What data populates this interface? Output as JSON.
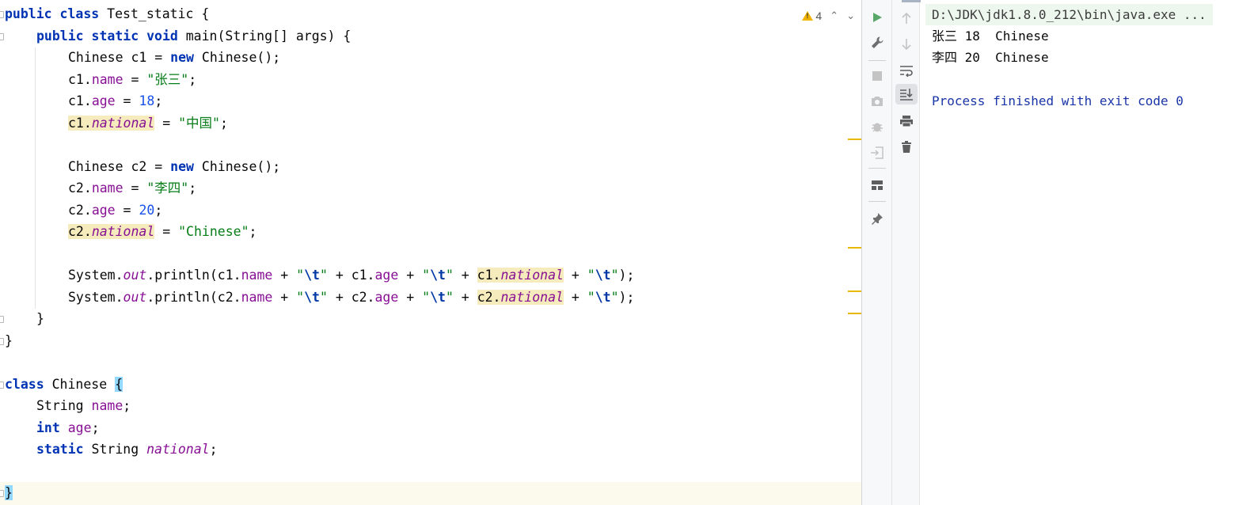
{
  "editor": {
    "inspection": {
      "warning_count": "4"
    },
    "code": {
      "l1": {
        "kw1": "public",
        "kw2": "class",
        "name": " Test_static {"
      },
      "l2": {
        "kw": "public static void",
        "rest": " main(String[] args) {"
      },
      "l3": {
        "a": "Chinese c1 = ",
        "kw": "new",
        "b": " Chinese();"
      },
      "l4": {
        "obj": "c1.",
        "field": "name",
        "op": " = ",
        "str": "\"张三\"",
        "end": ";"
      },
      "l5": {
        "obj": "c1.",
        "field": "age",
        "op": " = ",
        "num": "18",
        "end": ";"
      },
      "l6": {
        "obj": "c1.",
        "field": "national",
        "op": " = ",
        "str": "\"中国\"",
        "end": ";"
      },
      "l7": {
        "a": "Chinese c2 = ",
        "kw": "new",
        "b": " Chinese();"
      },
      "l8": {
        "obj": "c2.",
        "field": "name",
        "op": " = ",
        "str": "\"李四\"",
        "end": ";"
      },
      "l9": {
        "obj": "c2.",
        "field": "age",
        "op": " = ",
        "num": "20",
        "end": ";"
      },
      "l10": {
        "obj": "c2.",
        "field": "national",
        "op": " = ",
        "str": "\"Chinese\"",
        "end": ";"
      },
      "l11": {
        "sys": "System.",
        "out": "out",
        "call": ".println(c1.",
        "f1": "name",
        "plus1": " + ",
        "q": "\"",
        "tab": "\\t",
        "plus2": " + c1.",
        "f2": "age",
        "plus3": " + ",
        "plus4": " + ",
        "hlobj": "c1.",
        "f3": "national",
        "end": ");"
      },
      "l12": {
        "sys": "System.",
        "out": "out",
        "call": ".println(c2.",
        "f1": "name",
        "plus1": " + ",
        "q": "\"",
        "tab": "\\t",
        "plus2": " + c2.",
        "f2": "age",
        "plus3": " + ",
        "plus4": " + ",
        "hlobj": "c2.",
        "f3": "national",
        "end": ");"
      },
      "l13": {
        "text": "}"
      },
      "l14": {
        "text": "}"
      },
      "l15": {
        "kw": "class",
        "name": " Chinese ",
        "brace": "{"
      },
      "l16": {
        "type": "String ",
        "field": "name",
        "end": ";"
      },
      "l17": {
        "kw": "int",
        "sp": " ",
        "field": "age",
        "end": ";"
      },
      "l18": {
        "kw": "static",
        "type": " String ",
        "field": "national",
        "end": ";"
      },
      "l19": {
        "text": "}"
      }
    }
  },
  "run": {
    "left_toolbar": [
      "run-icon",
      "wrench-icon",
      "stop-icon",
      "camera-icon",
      "debug-bug-icon",
      "login-icon",
      "layout-icon",
      "pin-icon"
    ],
    "right_toolbar": [
      "arrow-up-icon",
      "arrow-down-icon",
      "soft-wrap-icon",
      "scroll-to-end-icon",
      "print-icon",
      "trash-icon"
    ],
    "console": {
      "command": "D:\\JDK\\jdk1.8.0_212\\bin\\java.exe ...",
      "out1": "张三 18  Chinese",
      "out2": "李四 20  Chinese",
      "finished": "Process finished with exit code 0"
    }
  },
  "colors": {
    "keyword": "#0033b3",
    "field": "#871094",
    "string": "#067d17",
    "number": "#1750eb",
    "warning_highlight": "#f6ebbc",
    "brace_highlight": "#93d9ff",
    "process_text": "#1a35a8"
  }
}
